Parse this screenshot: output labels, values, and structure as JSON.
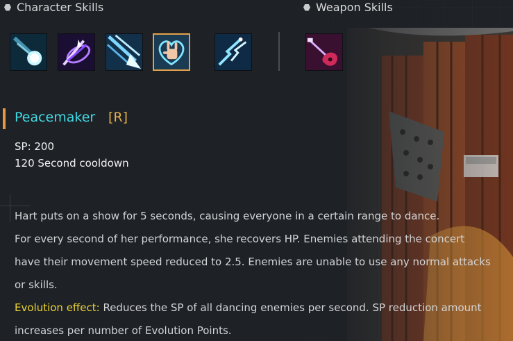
{
  "headers": {
    "character_skills": "Character Skills",
    "weapon_skills": "Weapon Skills"
  },
  "character_skill_icons": [
    {
      "name": "comet-skill-icon"
    },
    {
      "name": "purple-slash-skill-icon"
    },
    {
      "name": "arrow-volley-skill-icon"
    },
    {
      "name": "rock-hand-heart-skill-icon",
      "selected": true
    },
    {
      "name": "lightning-burst-skill-icon"
    }
  ],
  "weapon_skill_icons": [
    {
      "name": "electric-guitar-skill-icon"
    }
  ],
  "skill": {
    "name": "Peacemaker",
    "key": "[R]",
    "sp": "SP: 200",
    "cooldown": "120 Second cooldown"
  },
  "description": {
    "line1": "Hart puts on a show for 5 seconds, causing everyone in a certain range to dance.",
    "line2": "For every second of her performance, she recovers HP. Enemies attending the concert",
    "line3": "have their movement speed reduced to 2.5. Enemies are unable to use any normal attacks",
    "line4": "or skills.",
    "evolution_label": "Evolution effect:",
    "evolution_line1": " Reduces the SP of all dancing enemies per second. SP reduction amount",
    "evolution_line2": "increases per number of Evolution Points."
  },
  "colors": {
    "skill_name": "#42d9e2",
    "skill_key": "#e7b04a",
    "evolution_label": "#ecd434",
    "selected_border": "#e3a24a"
  }
}
